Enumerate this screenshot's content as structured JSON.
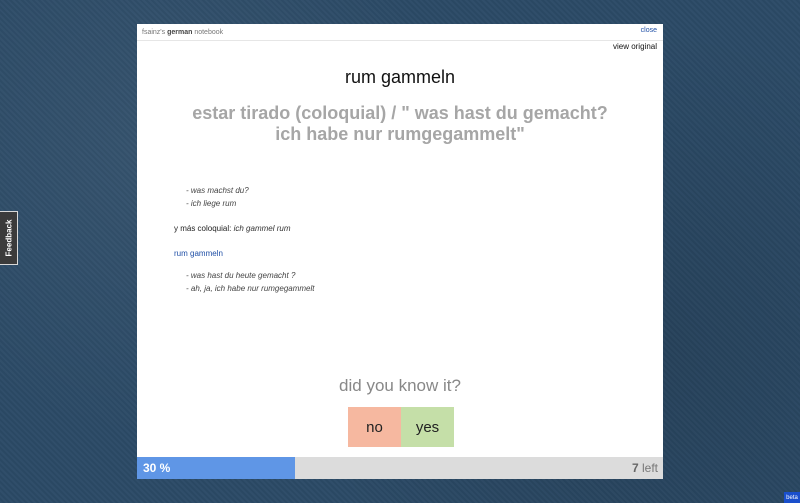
{
  "header": {
    "brand_prefix": "fsainz's",
    "brand_language": "german",
    "brand_suffix": "notebook",
    "close_label": "close",
    "view_original_label": "view original"
  },
  "card": {
    "word": "rum gammeln",
    "translation": "estar tirado (coloquial) / \" was hast du gemacht? ich habe nur rumgegammelt\"",
    "notes": {
      "example1_line1": "- was machst du?",
      "example1_line2": "- ich liege rum",
      "mas_prefix": "y más coloquial: ",
      "mas_italic": "ich gammel rum",
      "link": "rum gammeln",
      "example2_line1": "- was hast du heute gemacht ?",
      "example2_line2": "- ah, ja, ich habe nur rumgegammelt"
    }
  },
  "quiz": {
    "question": "did you know it?",
    "no_label": "no",
    "yes_label": "yes"
  },
  "progress": {
    "fraction": 0.3,
    "percent_label": "30 %",
    "left_count": "7",
    "left_label": " left"
  },
  "feedback_label": "Feedback",
  "beta_label": "beta",
  "colors": {
    "progress_fill": "#5f96e6",
    "no_button": "#f6b8a0",
    "yes_button": "#c5dfa8",
    "link": "#1f4fa6"
  }
}
